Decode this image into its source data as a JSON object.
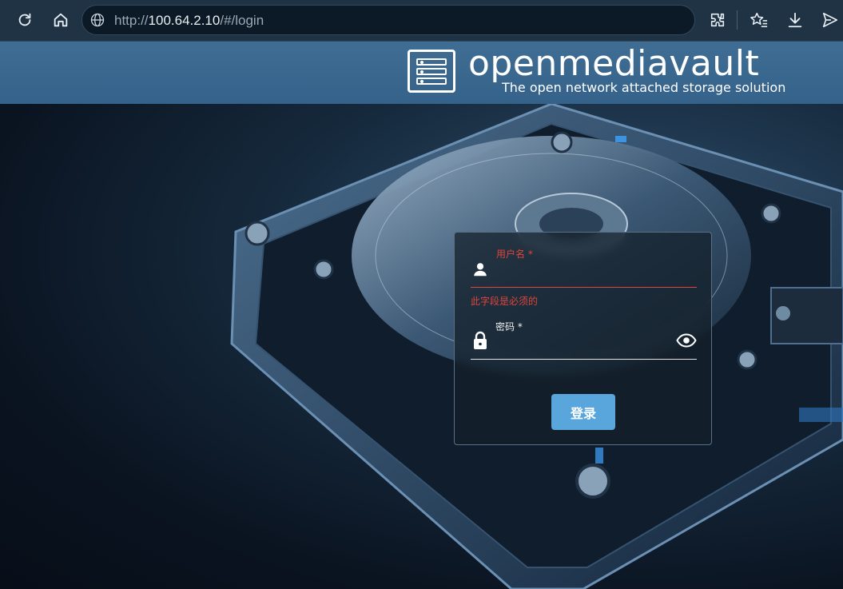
{
  "browser": {
    "url_scheme": "http://",
    "url_host": "100.64.2.10",
    "url_path": "/#/login",
    "icons": [
      "refresh-icon",
      "home-icon",
      "globe-icon",
      "extensions-icon",
      "favorites-icon",
      "downloads-icon",
      "share-icon"
    ]
  },
  "header": {
    "brand_name": "openmediavault",
    "tagline": "The open network attached storage solution",
    "background_color": "#3a6890"
  },
  "login": {
    "username_label": "用户名 *",
    "username_value": "",
    "username_error": "此字段是必须的",
    "password_label": "密码 *",
    "password_value": "",
    "submit_label": "登录",
    "error_color": "#e0453c",
    "button_color": "#58a6dc"
  }
}
